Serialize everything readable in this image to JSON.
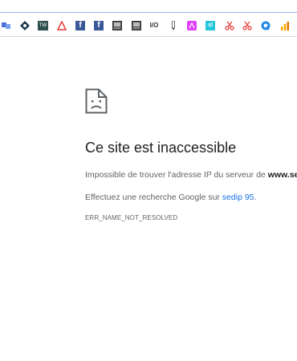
{
  "bookmarks": [
    {
      "icon": "bookmark-apps-icon",
      "label": ""
    },
    {
      "icon": "bookmark-robot-icon",
      "label": ""
    },
    {
      "icon": "bookmark-tw-icon",
      "label": "TW"
    },
    {
      "icon": "bookmark-triangle-icon",
      "label": ""
    },
    {
      "icon": "bookmark-facebook-icon",
      "label": "f"
    },
    {
      "icon": "bookmark-facebook-icon",
      "label": "f"
    },
    {
      "icon": "bookmark-photo-icon",
      "label": ""
    },
    {
      "icon": "bookmark-photo-icon",
      "label": ""
    },
    {
      "icon": "bookmark-io-icon",
      "label": "I/O"
    },
    {
      "icon": "bookmark-pen-icon",
      "label": ""
    },
    {
      "icon": "bookmark-pink-icon",
      "label": ""
    },
    {
      "icon": "bookmark-sl-icon",
      "label": "sl"
    },
    {
      "icon": "bookmark-scissors-icon",
      "label": ""
    },
    {
      "icon": "bookmark-scissors-icon",
      "label": ""
    },
    {
      "icon": "bookmark-q-icon",
      "label": ""
    },
    {
      "icon": "bookmark-analytics-icon",
      "label": ""
    }
  ],
  "error": {
    "title": "Ce site est inaccessible",
    "line1_prefix": "Impossible de trouver l'adresse IP du serveur de ",
    "line1_host": "www.se",
    "line2_prefix": "Effectuez une recherche Google sur ",
    "line2_link": "sedip 95",
    "line2_suffix": ".",
    "code": "ERR_NAME_NOT_RESOLVED"
  },
  "colors": {
    "link": "#1a73e8",
    "title": "#202124",
    "body_text": "#5f6368"
  }
}
